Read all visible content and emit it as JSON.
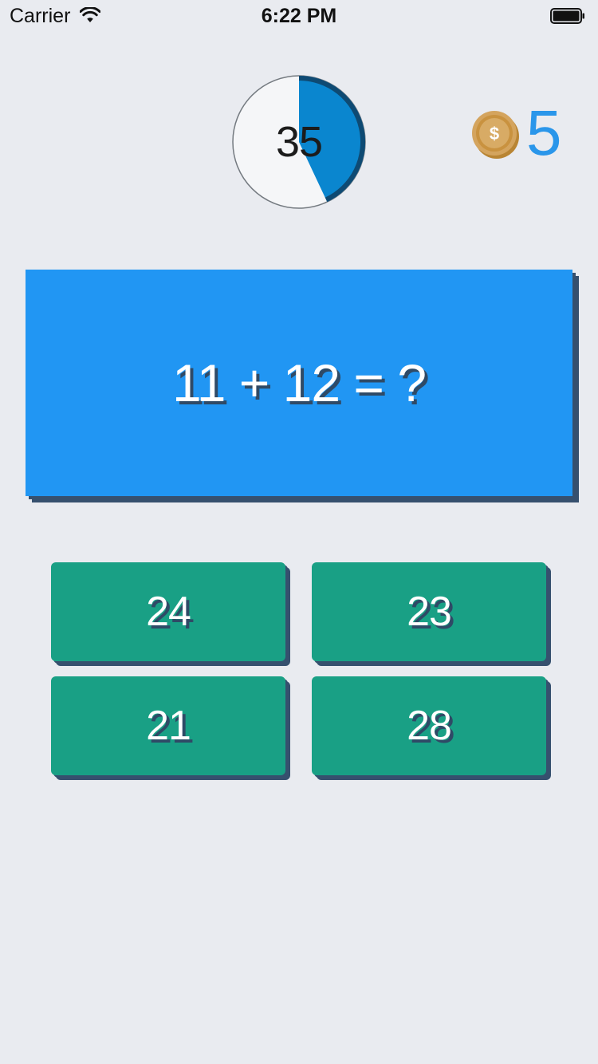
{
  "status_bar": {
    "carrier": "Carrier",
    "time": "6:22 PM",
    "wifi_icon": "wifi-icon",
    "battery_icon": "battery-icon"
  },
  "timer": {
    "value": "35",
    "remaining_fraction": 0.43,
    "fill_color": "#0a86cf",
    "ring_color": "#0e4a73"
  },
  "coins": {
    "icon": "coin-icon",
    "count": "5",
    "coin_symbol": "$"
  },
  "question": {
    "text": "11 + 12 = ?",
    "background": "#2196f3"
  },
  "answers": [
    {
      "label": "24"
    },
    {
      "label": "23"
    },
    {
      "label": "21"
    },
    {
      "label": "28"
    }
  ],
  "colors": {
    "background": "#e9ebf0",
    "answer_background": "#19a085",
    "shadow": "#36506e",
    "accent_text": "#2a96ea"
  }
}
